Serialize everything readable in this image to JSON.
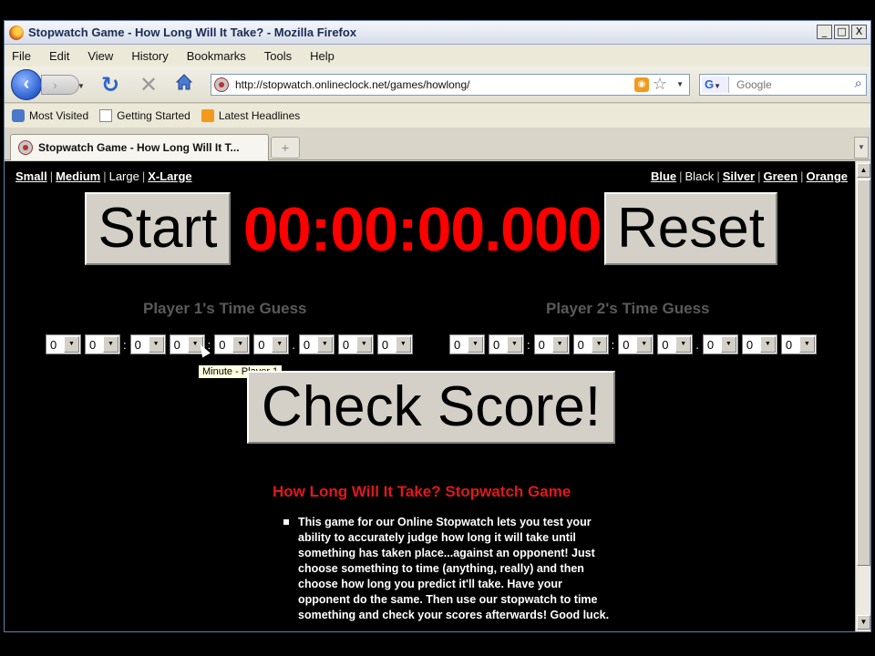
{
  "window": {
    "title": "Stopwatch Game - How Long Will It Take? - Mozilla Firefox",
    "buttons": {
      "minimize": "_",
      "maximize": "□",
      "close": "X"
    }
  },
  "menu": [
    "File",
    "Edit",
    "View",
    "History",
    "Bookmarks",
    "Tools",
    "Help"
  ],
  "nav": {
    "back_icon": "back-arrow-icon",
    "url": "http://stopwatch.onlineclock.net/games/howlong/",
    "search_placeholder": "Google"
  },
  "bookmarks": [
    "Most Visited",
    "Getting Started",
    "Latest Headlines"
  ],
  "tab": {
    "label": "Stopwatch Game - How Long Will It T...",
    "new_tab": "+"
  },
  "page": {
    "size_links": {
      "small": "Small",
      "medium": "Medium",
      "large": "Large",
      "xlarge": "X-Large",
      "separator": "|"
    },
    "color_links": {
      "blue": "Blue",
      "black": "Black",
      "silver": "Silver",
      "green": "Green",
      "orange": "Orange"
    },
    "start_label": "Start",
    "timer": "00:00:00.000",
    "reset_label": "Reset",
    "player1_label": "Player 1's Time Guess",
    "player2_label": "Player 2's Time Guess",
    "player1_digits": [
      "0",
      "0",
      "0",
      "0",
      "0",
      "0",
      "0",
      "0",
      "0"
    ],
    "player2_digits": [
      "0",
      "0",
      "0",
      "0",
      "0",
      "0",
      "0",
      "0",
      "0"
    ],
    "tooltip": "Minute - Player 1",
    "check_label": "Check Score!",
    "game_title": "How Long Will It Take? Stopwatch Game",
    "description": "This game for our Online Stopwatch lets you test your ability to accurately judge how long it will take until something has taken place...against an opponent! Just choose something to time (anything, really) and then choose how long you predict it'll take. Have your opponent do the same. Then use our stopwatch to time something and check your scores afterwards! Good luck."
  },
  "colors": {
    "timer": "#ff0000",
    "game_title": "#e0181c",
    "guess_label": "#5a5a5a",
    "background": "#000000"
  }
}
